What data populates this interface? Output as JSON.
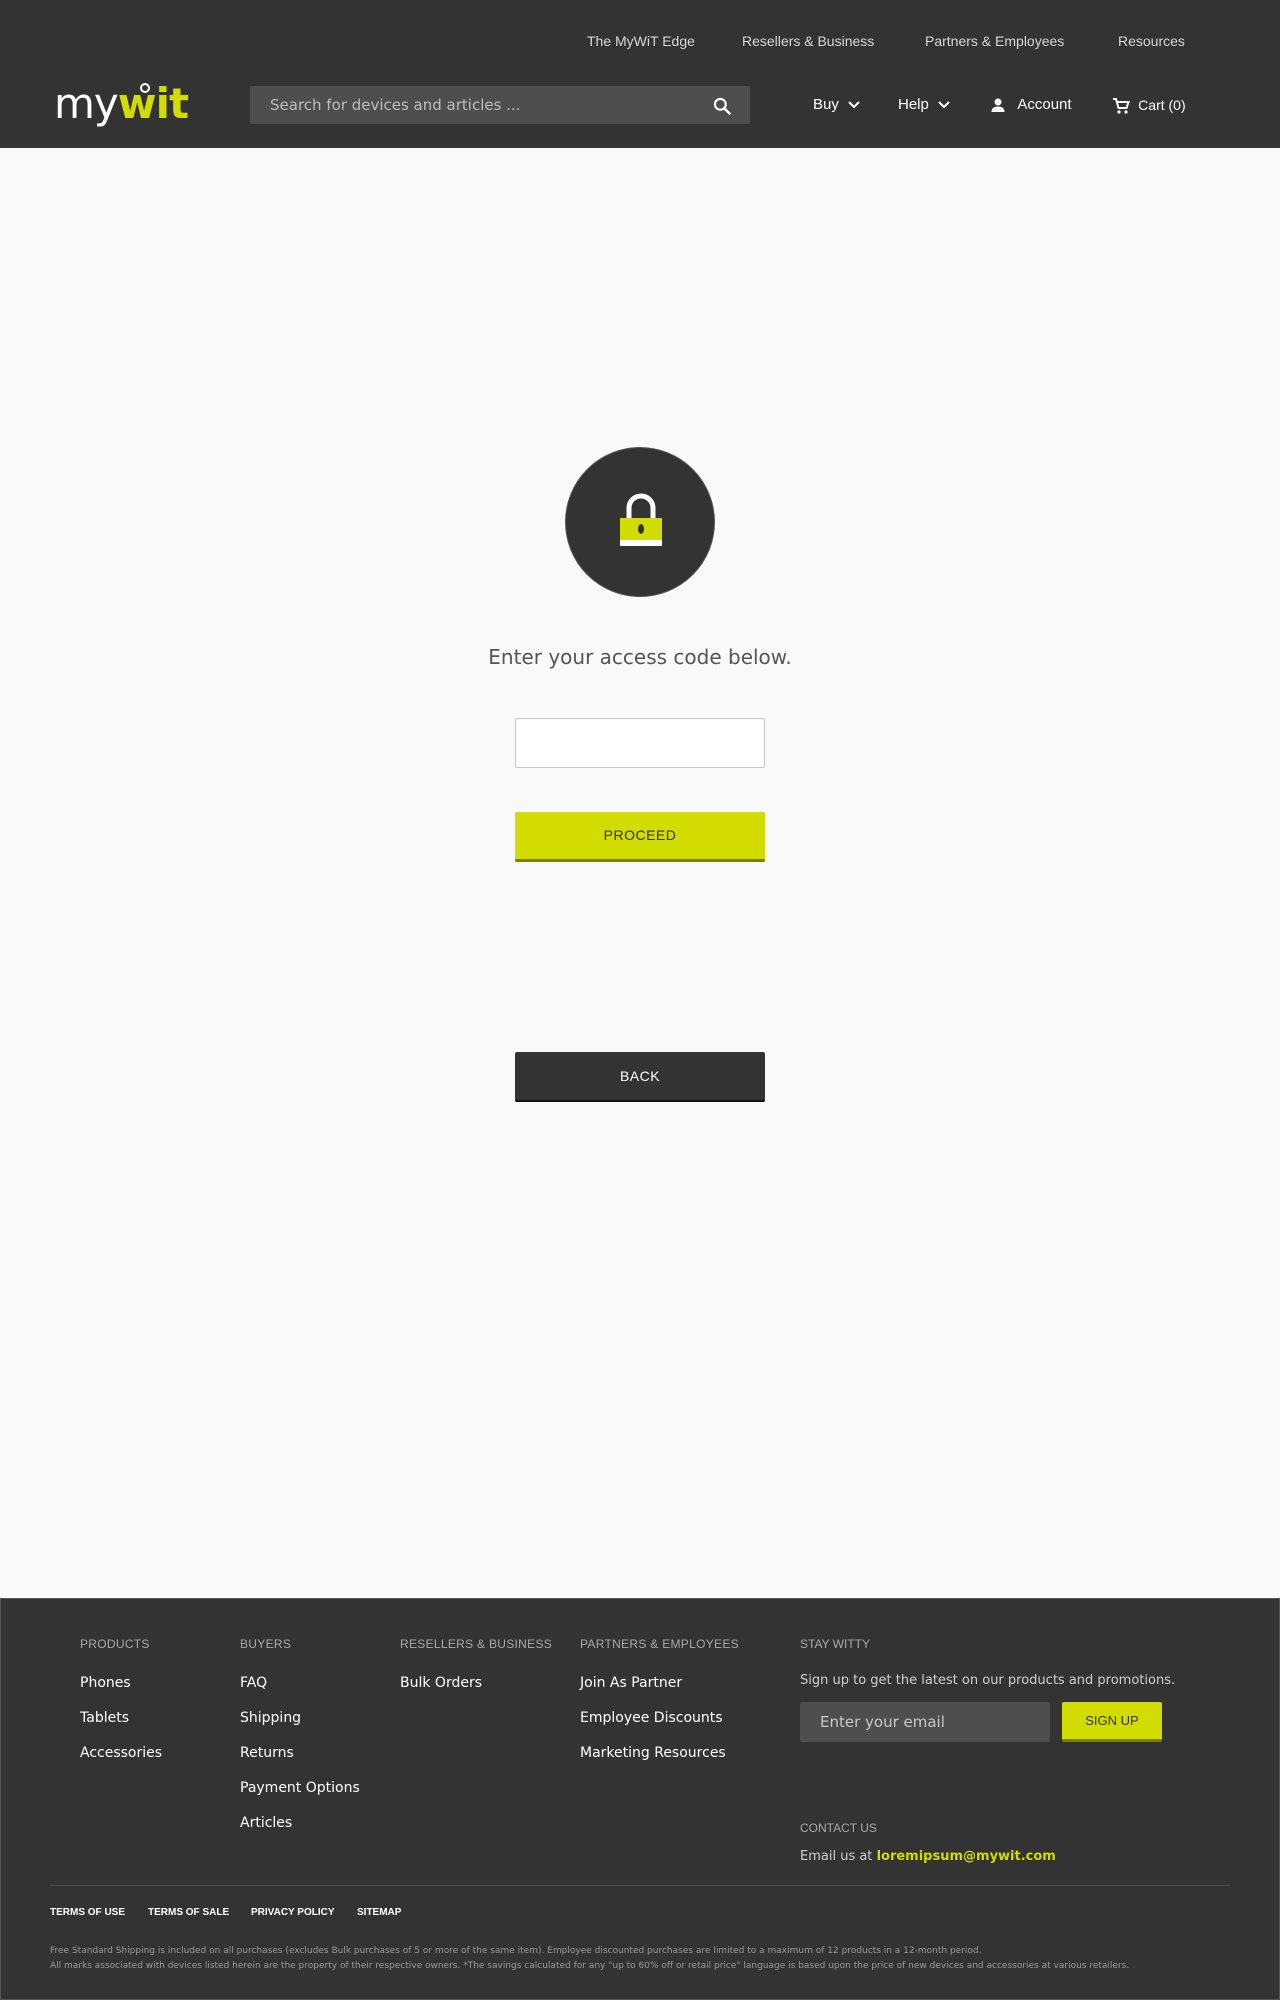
{
  "header": {
    "top_nav": [
      "The MyWiT Edge",
      "Resellers & Business",
      "Partners & Employees",
      "Resources"
    ],
    "logo": {
      "my": "my",
      "wit": "wit"
    },
    "search": {
      "placeholder": "Search for devices and articles ..."
    },
    "nav": {
      "buy": "Buy",
      "help": "Help",
      "account": "Account",
      "cart": "Cart (0)"
    }
  },
  "main": {
    "prompt": "Enter your access code below.",
    "code_input_value": "",
    "proceed_label": "PROCEED",
    "back_label": "BACK"
  },
  "footer": {
    "columns": [
      {
        "heading": "PRODUCTS",
        "links": [
          "Phones",
          "Tablets",
          "Accessories"
        ]
      },
      {
        "heading": "BUYERS",
        "links": [
          "FAQ",
          "Shipping",
          "Returns",
          "Payment Options",
          "Articles"
        ]
      },
      {
        "heading": "RESELLERS & BUSINESS",
        "links": [
          "Bulk Orders"
        ]
      },
      {
        "heading": "PARTNERS & EMPLOYEES",
        "links": [
          "Join As Partner",
          "Employee Discounts",
          "Marketing Resources"
        ]
      }
    ],
    "stay": {
      "heading": "STAY WITTY",
      "text": "Sign up to get the latest on our products and promotions.",
      "email_placeholder": "Enter your email",
      "signup_label": "SIGN UP"
    },
    "contact": {
      "heading": "CONTACT US",
      "prefix": "Email us at",
      "email": "loremipsum@mywit.com"
    },
    "legal_links": [
      "TERMS OF USE",
      "TERMS OF SALE",
      "PRIVACY POLICY",
      "SITEMAP"
    ],
    "fine_print": [
      "Free Standard Shipping is included on all purchases (excludes Bulk purchases of 5 or more of the same item). Employee discounted purchases are limited to a maximum of 12 products in a 12-month period.",
      "All marks associated with devices listed herein are the property of their respective owners. *The savings calculated for any \"up to 60% off or retail price\" language is based upon the price of new devices and accessories at various retailers."
    ]
  },
  "colors": {
    "accent": "#d2dc00",
    "dark": "#333333",
    "page_bg": "#f9f9f9"
  }
}
